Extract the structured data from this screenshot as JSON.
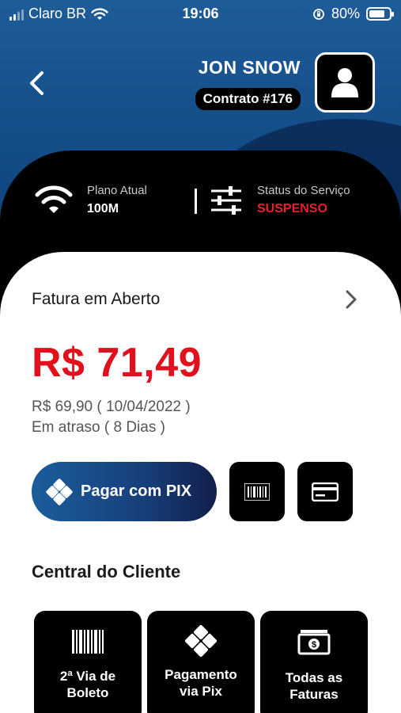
{
  "status_bar": {
    "carrier": "Claro BR",
    "time": "19:06",
    "battery_percent": "80%",
    "battery_level": 0.8
  },
  "header": {
    "user_name": "JON SNOW",
    "contract": "Contrato #176"
  },
  "service": {
    "plan_label": "Plano Atual",
    "plan_value": "100M",
    "status_label": "Status do Serviço",
    "status_value": "SUSPENSO",
    "status_color": "#e8202a"
  },
  "invoice": {
    "title": "Fatura em Aberto",
    "amount": "R$ 71,49",
    "original": "R$ 69,90 ( 10/04/2022 )",
    "overdue": "Em atraso ( 8 Dias )",
    "amount_color": "#e0101d"
  },
  "actions": {
    "pix_button": "Pagar com PIX"
  },
  "central": {
    "title": "Central do Cliente",
    "tiles": [
      {
        "line1": "2ª Via de",
        "line2": "Boleto",
        "icon": "barcode-icon"
      },
      {
        "line1": "Pagamento",
        "line2": "via Pix",
        "icon": "pix-icon"
      },
      {
        "line1": "Todas as",
        "line2": "Faturas",
        "icon": "money-icon"
      }
    ]
  },
  "colors": {
    "header_blue": "#1e5c98",
    "card_black": "#000000",
    "pix_gradient_start": "#1b5d9c",
    "pix_gradient_end": "#121f4a"
  }
}
